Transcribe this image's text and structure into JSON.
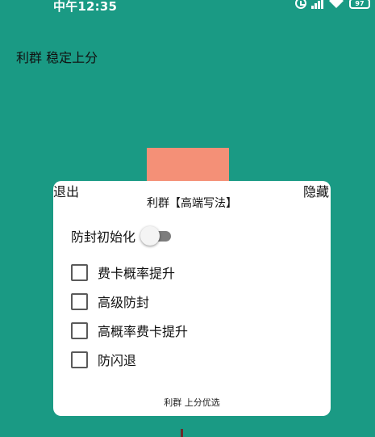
{
  "status_bar": {
    "time": "中午12:35",
    "battery": "97",
    "icons": [
      "alarm-icon",
      "signal-icon",
      "wifi-icon",
      "battery-icon"
    ]
  },
  "app": {
    "title": "利群 稳定上分"
  },
  "dialog": {
    "exit_label": "退出",
    "hide_label": "隐藏",
    "title": "利群【高端写法】",
    "toggle": {
      "label": "防封初始化",
      "on": false
    },
    "options": [
      {
        "label": "费卡概率提升",
        "checked": false
      },
      {
        "label": "高级防封",
        "checked": false
      },
      {
        "label": "高概率费卡提升",
        "checked": false
      },
      {
        "label": "防闪退",
        "checked": false
      }
    ],
    "footer": "利群 上分优选"
  },
  "colors": {
    "background": "#1a9a84",
    "accent_block": "#f49077",
    "dialog_bg": "#ffffff"
  }
}
